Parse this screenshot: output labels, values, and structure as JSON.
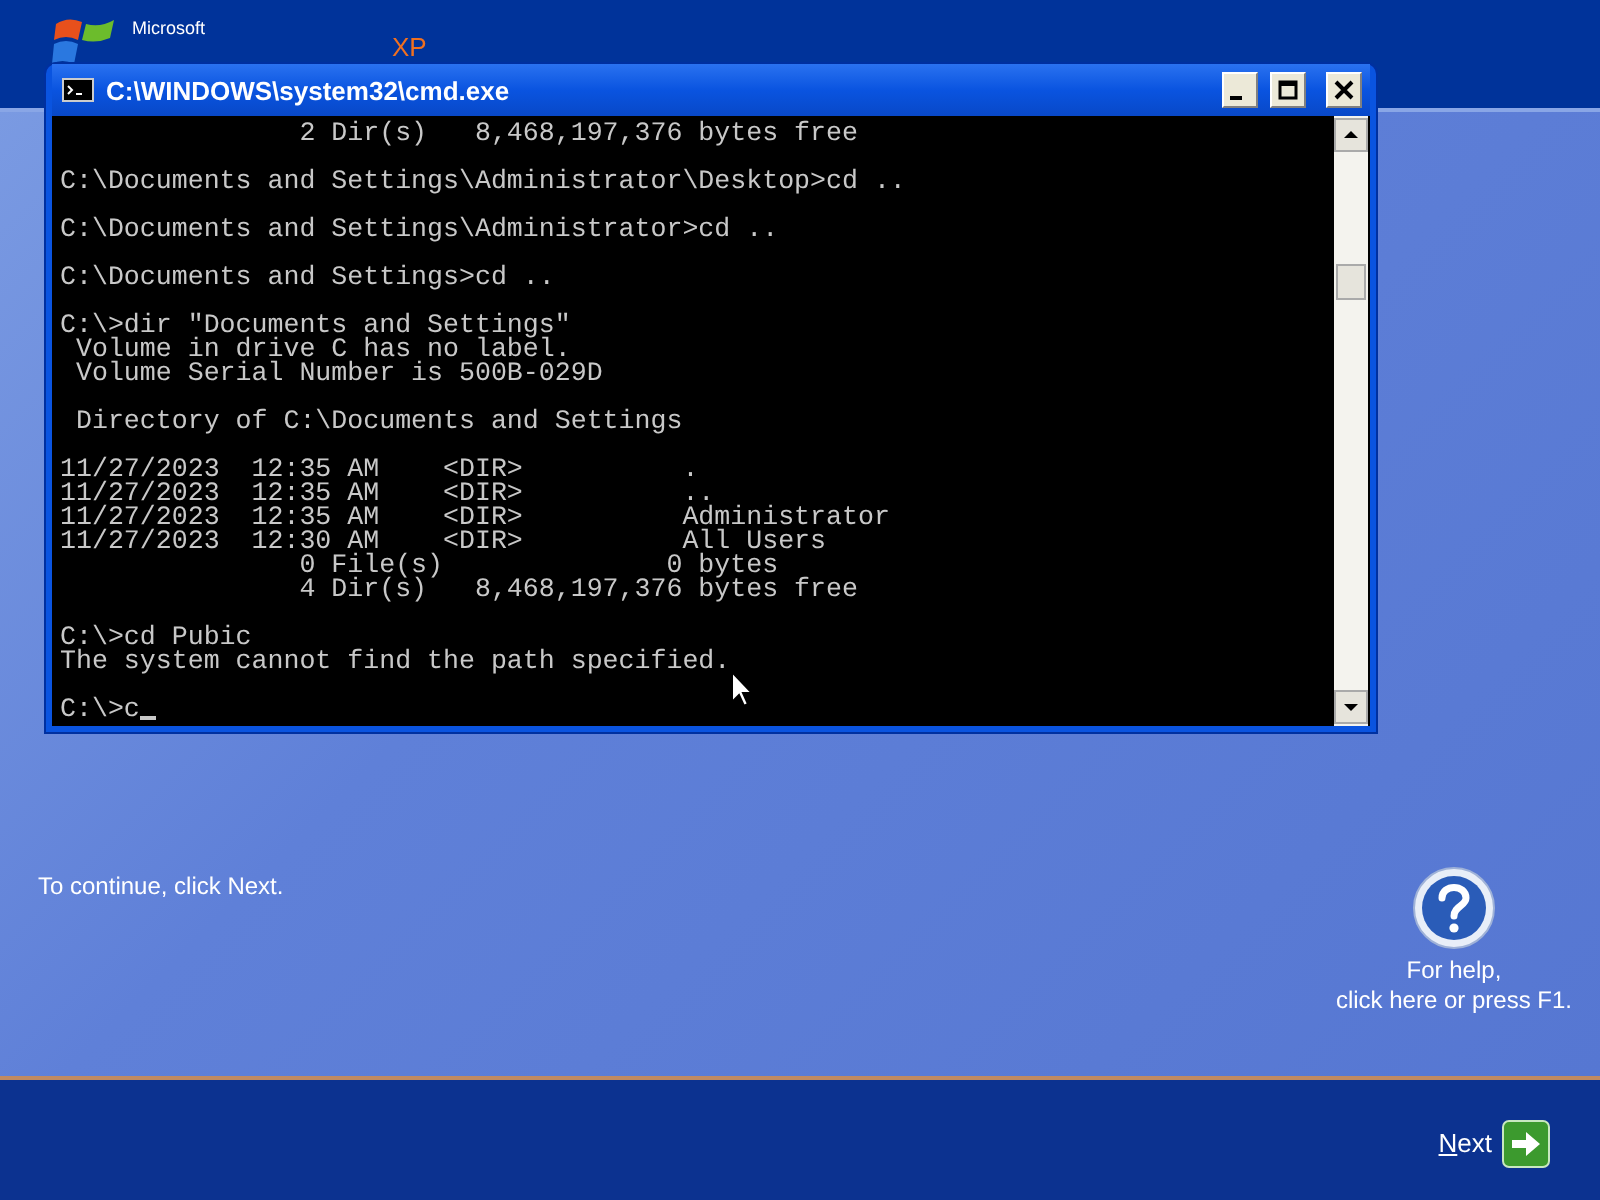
{
  "logo": {
    "maker": "Microsoft",
    "edition": "XP"
  },
  "window": {
    "title": "C:\\WINDOWS\\system32\\cmd.exe"
  },
  "console": {
    "blocks": [
      [
        "               2 Dir(s)   8,468,197,376 bytes free"
      ],
      [
        "C:\\Documents and Settings\\Administrator\\Desktop>cd .."
      ],
      [
        "C:\\Documents and Settings\\Administrator>cd .."
      ],
      [
        "C:\\Documents and Settings>cd .."
      ],
      [
        "C:\\>dir \"Documents and Settings\"",
        " Volume in drive C has no label.",
        " Volume Serial Number is 500B-029D"
      ],
      [
        " Directory of C:\\Documents and Settings"
      ],
      [
        "11/27/2023  12:35 AM    <DIR>          .",
        "11/27/2023  12:35 AM    <DIR>          ..",
        "11/27/2023  12:35 AM    <DIR>          Administrator",
        "11/27/2023  12:30 AM    <DIR>          All Users",
        "               0 File(s)              0 bytes",
        "               4 Dir(s)   8,468,197,376 bytes free"
      ],
      [
        "C:\\>cd Pubic",
        "The system cannot find the path specified."
      ]
    ],
    "input_line": "C:\\>c"
  },
  "instruction": "To continue, click Next.",
  "help_text": "For help,\nclick here or press F1.",
  "next_button": {
    "label": "Next"
  }
}
